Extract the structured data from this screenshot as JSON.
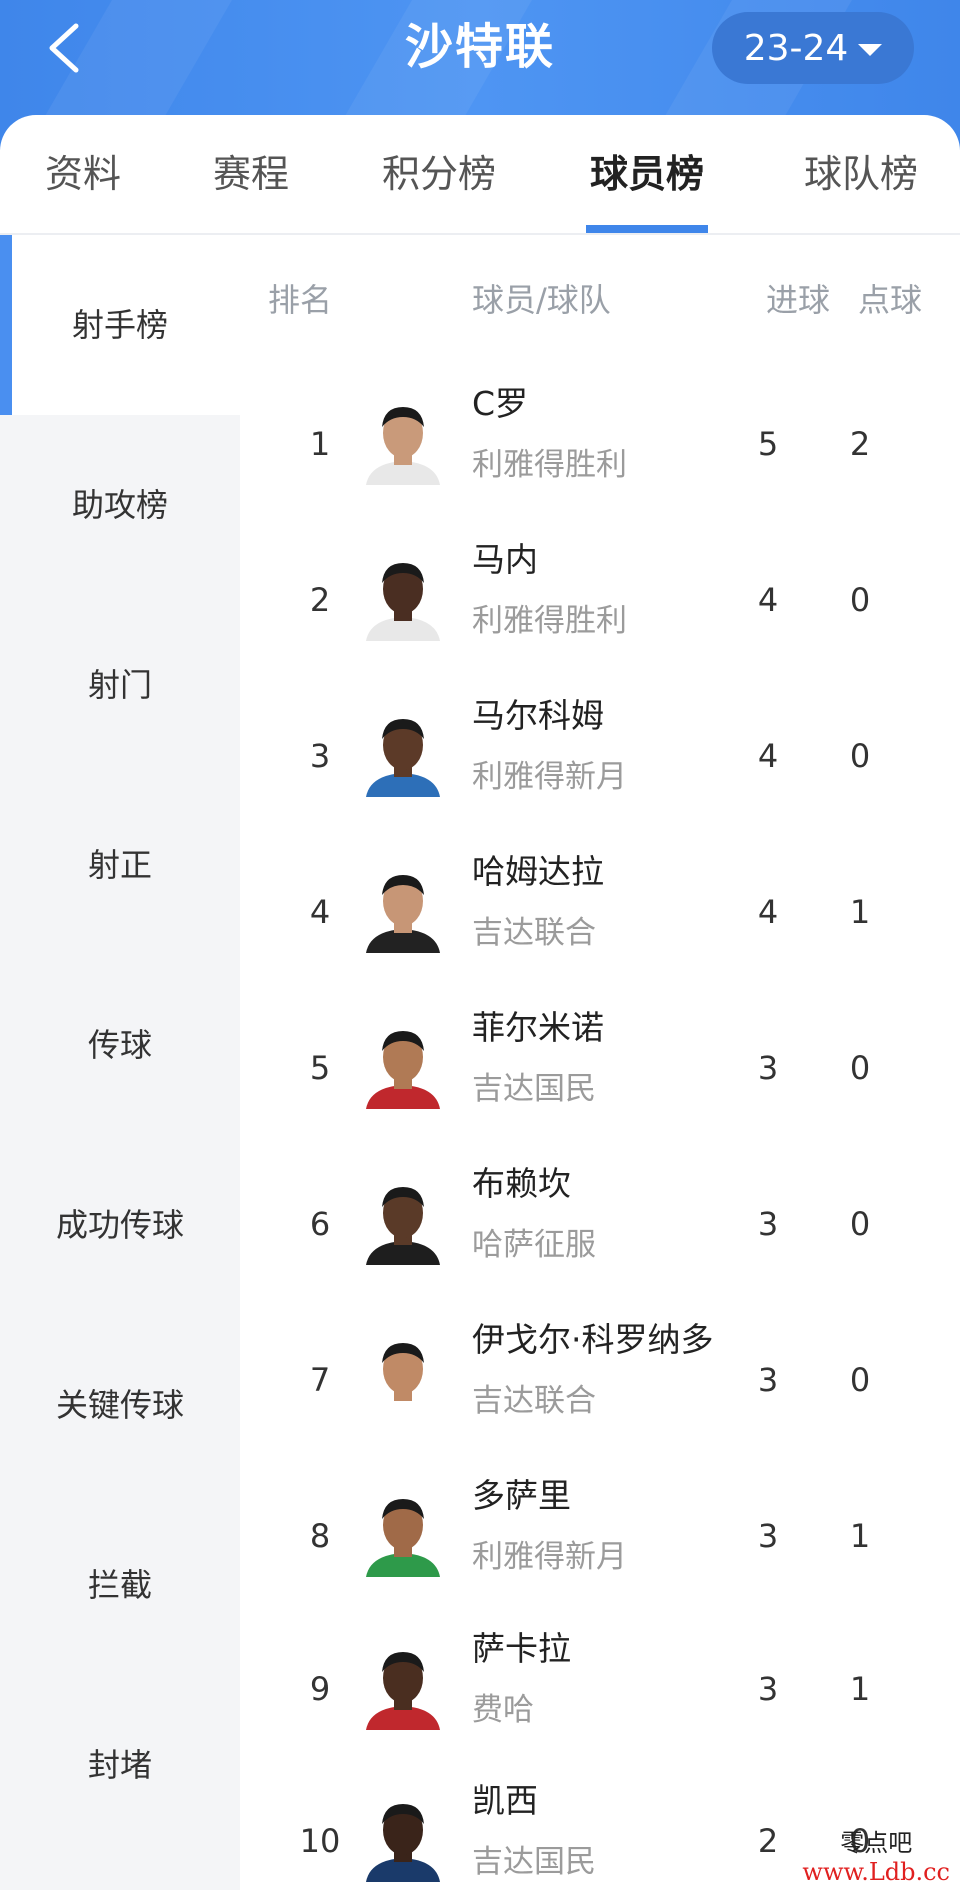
{
  "header": {
    "title": "沙特联",
    "season": "23-24",
    "back_icon": "chevron-left-icon",
    "season_caret_icon": "caret-down-icon",
    "bg_color": "#4a8ff0"
  },
  "tabs": [
    {
      "label": "资料",
      "active": false
    },
    {
      "label": "赛程",
      "active": false
    },
    {
      "label": "积分榜",
      "active": false
    },
    {
      "label": "球员榜",
      "active": true
    },
    {
      "label": "球队榜",
      "active": false
    }
  ],
  "sidebar": {
    "items": [
      {
        "label": "射手榜",
        "active": true
      },
      {
        "label": "助攻榜",
        "active": false
      },
      {
        "label": "射门",
        "active": false
      },
      {
        "label": "射正",
        "active": false
      },
      {
        "label": "传球",
        "active": false
      },
      {
        "label": "成功传球",
        "active": false
      },
      {
        "label": "关键传球",
        "active": false
      },
      {
        "label": "拦截",
        "active": false
      },
      {
        "label": "封堵",
        "active": false
      }
    ]
  },
  "table": {
    "headers": {
      "rank": "排名",
      "player": "球员/球队",
      "goals": "进球",
      "penalties": "点球"
    },
    "rows": [
      {
        "rank": "1",
        "name": "C罗",
        "team": "利雅得胜利",
        "goals": "5",
        "penalties": "2"
      },
      {
        "rank": "2",
        "name": "马内",
        "team": "利雅得胜利",
        "goals": "4",
        "penalties": "0"
      },
      {
        "rank": "3",
        "name": "马尔科姆",
        "team": "利雅得新月",
        "goals": "4",
        "penalties": "0"
      },
      {
        "rank": "4",
        "name": "哈姆达拉",
        "team": "吉达联合",
        "goals": "4",
        "penalties": "1"
      },
      {
        "rank": "5",
        "name": "菲尔米诺",
        "team": "吉达国民",
        "goals": "3",
        "penalties": "0"
      },
      {
        "rank": "6",
        "name": "布赖坎",
        "team": "哈萨征服",
        "goals": "3",
        "penalties": "0"
      },
      {
        "rank": "7",
        "name": "伊戈尔·科罗纳多",
        "team": "吉达联合",
        "goals": "3",
        "penalties": "0"
      },
      {
        "rank": "8",
        "name": "多萨里",
        "team": "利雅得新月",
        "goals": "3",
        "penalties": "1"
      },
      {
        "rank": "9",
        "name": "萨卡拉",
        "team": "费哈",
        "goals": "3",
        "penalties": "1"
      },
      {
        "rank": "10",
        "name": "凯西",
        "team": "吉达国民",
        "goals": "2",
        "penalties": "0"
      }
    ]
  },
  "watermark": {
    "title": "零点吧",
    "url": "www.Ldb.cc"
  }
}
